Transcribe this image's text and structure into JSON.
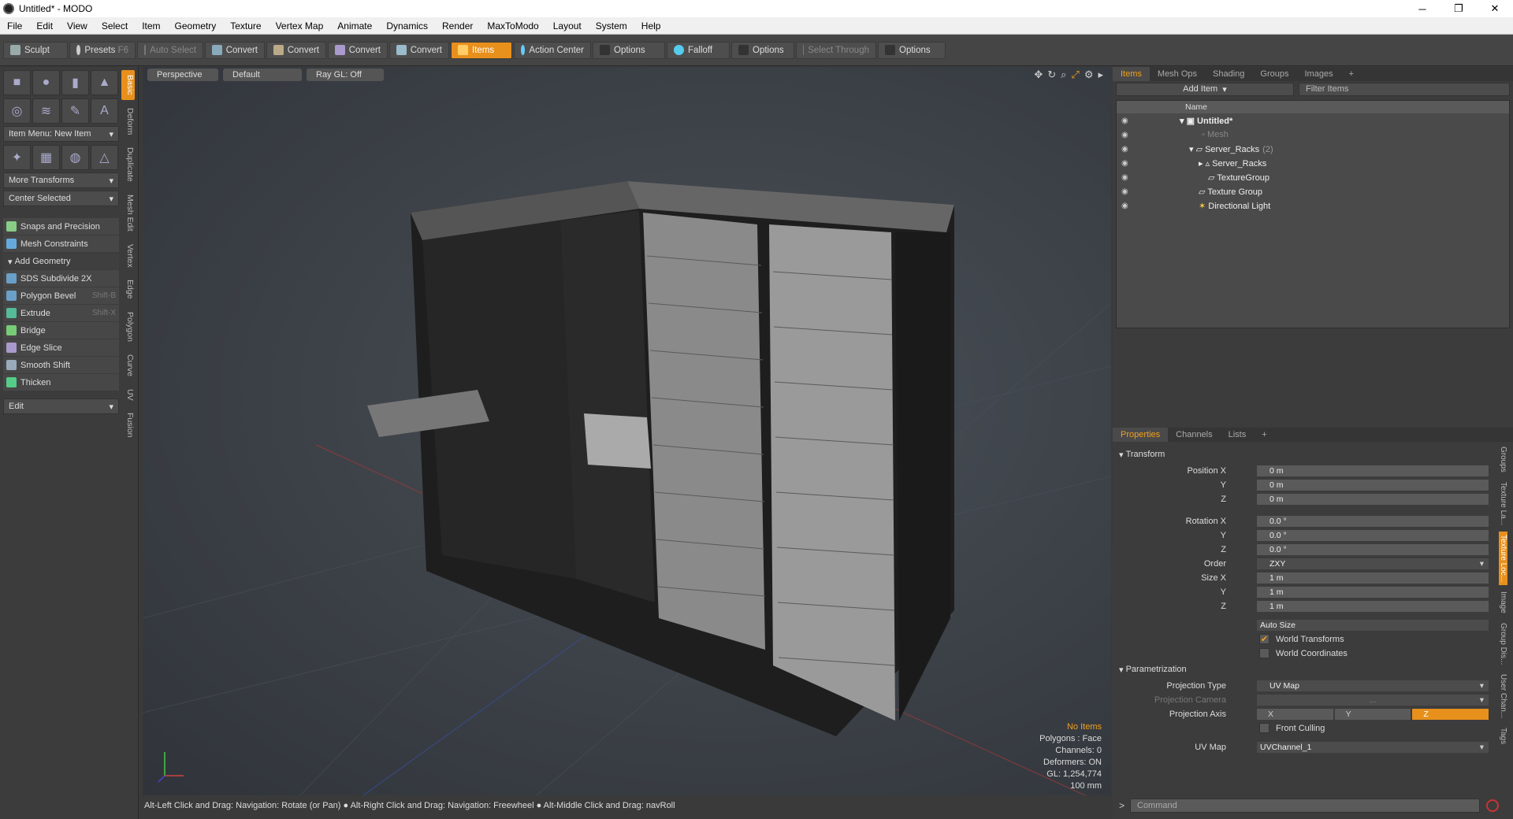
{
  "window": {
    "title": "Untitled* - MODO",
    "min": "─",
    "max": "❐",
    "close": "✕"
  },
  "menu": [
    "File",
    "Edit",
    "View",
    "Select",
    "Item",
    "Geometry",
    "Texture",
    "Vertex Map",
    "Animate",
    "Dynamics",
    "Render",
    "MaxToModo",
    "Layout",
    "System",
    "Help"
  ],
  "toolbar": {
    "sculpt": "Sculpt",
    "presets": "Presets",
    "presets_key": "F6",
    "auto_select": "Auto Select",
    "convert": "Convert",
    "items": "Items",
    "action_center": "Action Center",
    "options": "Options",
    "falloff": "Falloff",
    "select_through": "Select Through"
  },
  "left": {
    "item_menu": "Item Menu: New Item",
    "more_transforms": "More Transforms",
    "center_selected": "Center Selected",
    "snaps": "Snaps and Precision",
    "mesh_constraints": "Mesh Constraints",
    "add_geometry": "Add Geometry",
    "tools": [
      {
        "label": "SDS Subdivide 2X",
        "key": ""
      },
      {
        "label": "Polygon Bevel",
        "key": "Shift-B"
      },
      {
        "label": "Extrude",
        "key": "Shift-X"
      },
      {
        "label": "Bridge",
        "key": ""
      },
      {
        "label": "Edge Slice",
        "key": ""
      },
      {
        "label": "Smooth Shift",
        "key": ""
      },
      {
        "label": "Thicken",
        "key": ""
      }
    ],
    "edit": "Edit",
    "vtabs": [
      "Basic",
      "Deform",
      "Duplicate",
      "Mesh Edit",
      "Vertex",
      "Edge",
      "Polygon",
      "Curve",
      "UV",
      "Fusion"
    ]
  },
  "viewport": {
    "view": "Perspective",
    "shading": "Default",
    "raygl": "Ray GL: Off",
    "info": {
      "no_items": "No Items",
      "polygons": "Polygons : Face",
      "channels": "Channels: 0",
      "deformers": "Deformers: ON",
      "gl": "GL: 1,254,774",
      "scale": "100 mm"
    }
  },
  "status": "Alt-Left Click and Drag: Navigation: Rotate (or Pan) ● Alt-Right Click and Drag: Navigation: Freewheel ● Alt-Middle Click and Drag: navRoll",
  "items_panel": {
    "tabs": [
      "Items",
      "Mesh Ops",
      "Shading",
      "Groups",
      "Images"
    ],
    "add_item": "Add Item",
    "filter": "Filter Items",
    "col_name": "Name",
    "tree": [
      {
        "label": "Untitled*",
        "count": ""
      },
      {
        "label": "Mesh",
        "count": ""
      },
      {
        "label": "Server_Racks",
        "count": "(2)"
      },
      {
        "label": "Server_Racks",
        "count": ""
      },
      {
        "label": "TextureGroup",
        "count": ""
      },
      {
        "label": "Texture Group",
        "count": ""
      },
      {
        "label": "Directional Light",
        "count": ""
      }
    ]
  },
  "properties": {
    "tabs": [
      "Properties",
      "Channels",
      "Lists"
    ],
    "transform": "Transform",
    "pos_x": "Position X",
    "pos_y": "Y",
    "pos_z": "Z",
    "pos_vals": [
      "0 m",
      "0 m",
      "0 m"
    ],
    "rot_x": "Rotation X",
    "rot_y": "Y",
    "rot_z": "Z",
    "rot_vals": [
      "0.0 °",
      "0.0 °",
      "0.0 °"
    ],
    "order_label": "Order",
    "order": "ZXY",
    "size_x": "Size X",
    "size_y": "Y",
    "size_z": "Z",
    "size_vals": [
      "1 m",
      "1 m",
      "1 m"
    ],
    "auto_size": "Auto Size",
    "world_transforms": "World Transforms",
    "world_coords": "World Coordinates",
    "parametrization": "Parametrization",
    "proj_type_label": "Projection Type",
    "proj_type": "UV Map",
    "proj_cam_label": "Projection Camera",
    "proj_cam": "...",
    "proj_axis_label": "Projection Axis",
    "axes": [
      "X",
      "Y",
      "Z"
    ],
    "front_culling": "Front Culling",
    "uvmap_label": "UV Map",
    "uvmap": "UVChannel_1",
    "rvtabs": [
      "Groups",
      "Texture La...",
      "Texture Loc...",
      "Image",
      "Group Dis...",
      "User Chan...",
      "Tags"
    ]
  },
  "command_placeholder": "Command"
}
